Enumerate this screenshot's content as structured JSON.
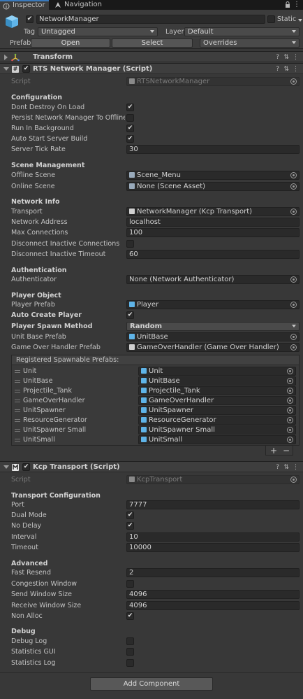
{
  "tabs": [
    {
      "label": "Inspector",
      "icon": "info-icon",
      "active": true
    },
    {
      "label": "Navigation",
      "icon": "navigation-icon",
      "active": false
    }
  ],
  "object": {
    "name": "NetworkManager",
    "active": true,
    "static_label": "Static",
    "tag_label": "Tag",
    "tag_value": "Untagged",
    "layer_label": "Layer",
    "layer_value": "Default",
    "prefab_label": "Prefab",
    "open_label": "Open",
    "select_label": "Select",
    "overrides_label": "Overrides"
  },
  "transform": {
    "title": "Transform"
  },
  "rts": {
    "title": "RTS Network Manager (Script)",
    "script_label": "Script",
    "script_value": "RTSNetworkManager",
    "configuration": "Configuration",
    "dont_destroy_label": "Dont Destroy On Load",
    "dont_destroy": true,
    "persist_label": "Persist Network Manager To Offline Sc",
    "persist": false,
    "run_bg_label": "Run In Background",
    "run_bg": true,
    "auto_start_label": "Auto Start Server Build",
    "auto_start": true,
    "tick_label": "Server Tick Rate",
    "tick_value": "30",
    "scene_management": "Scene Management",
    "offline_scene_label": "Offline Scene",
    "offline_scene_value": "Scene_Menu",
    "online_scene_label": "Online Scene",
    "online_scene_value": "None (Scene Asset)",
    "network_info": "Network Info",
    "transport_label": "Transport",
    "transport_value": "NetworkManager (Kcp Transport)",
    "address_label": "Network Address",
    "address_value": "localhost",
    "max_conn_label": "Max Connections",
    "max_conn_value": "100",
    "disconnect_inactive_label": "Disconnect Inactive Connections",
    "disconnect_inactive": false,
    "disconnect_timeout_label": "Disconnect Inactive Timeout",
    "disconnect_timeout_value": "60",
    "authentication": "Authentication",
    "authenticator_label": "Authenticator",
    "authenticator_value": "None (Network Authenticator)",
    "player_object": "Player Object",
    "player_prefab_label": "Player Prefab",
    "player_prefab_value": "Player",
    "auto_create_label": "Auto Create Player",
    "auto_create": true,
    "spawn_method_label": "Player Spawn Method",
    "spawn_method_value": "Random",
    "unit_base_label": "Unit Base Prefab",
    "unit_base_value": "UnitBase",
    "game_over_label": "Game Over Handler Prefab",
    "game_over_value": "GameOverHandler (Game Over Handler)",
    "registered_label": "Registered Spawnable Prefabs:",
    "registered": [
      {
        "name": "Unit",
        "value": "Unit"
      },
      {
        "name": "UnitBase",
        "value": "UnitBase"
      },
      {
        "name": "Projectile_Tank",
        "value": "Projectile_Tank"
      },
      {
        "name": "GameOverHandler",
        "value": "GameOverHandler"
      },
      {
        "name": "UnitSpawner",
        "value": "UnitSpawner"
      },
      {
        "name": "ResourceGenerator",
        "value": "ResourceGenerator"
      },
      {
        "name": "UnitSpawner Small",
        "value": "UnitSpawner Small"
      },
      {
        "name": "UnitSmall",
        "value": "UnitSmall"
      }
    ],
    "add_symbol": "+",
    "remove_symbol": "−"
  },
  "kcp": {
    "title": "Kcp Transport (Script)",
    "script_label": "Script",
    "script_value": "KcpTransport",
    "transport_configuration": "Transport Configuration",
    "port_label": "Port",
    "port_value": "7777",
    "dual_mode_label": "Dual Mode",
    "dual_mode": true,
    "no_delay_label": "No Delay",
    "no_delay": true,
    "interval_label": "Interval",
    "interval_value": "10",
    "timeout_label": "Timeout",
    "timeout_value": "10000",
    "advanced": "Advanced",
    "fast_resend_label": "Fast Resend",
    "fast_resend_value": "2",
    "congestion_label": "Congestion Window",
    "congestion": false,
    "send_window_label": "Send Window Size",
    "send_window_value": "4096",
    "receive_window_label": "Receive Window Size",
    "receive_window_value": "4096",
    "non_alloc_label": "Non Alloc",
    "non_alloc": true,
    "debug": "Debug",
    "debug_log_label": "Debug Log",
    "debug_log": false,
    "stats_gui_label": "Statistics GUI",
    "stats_gui": false,
    "stats_log_label": "Statistics Log",
    "stats_log": false
  },
  "add_component_label": "Add Component",
  "colors": {
    "accent": "#3a79bb",
    "prefab_blue": "#5fb4e8",
    "background": "#383838"
  }
}
